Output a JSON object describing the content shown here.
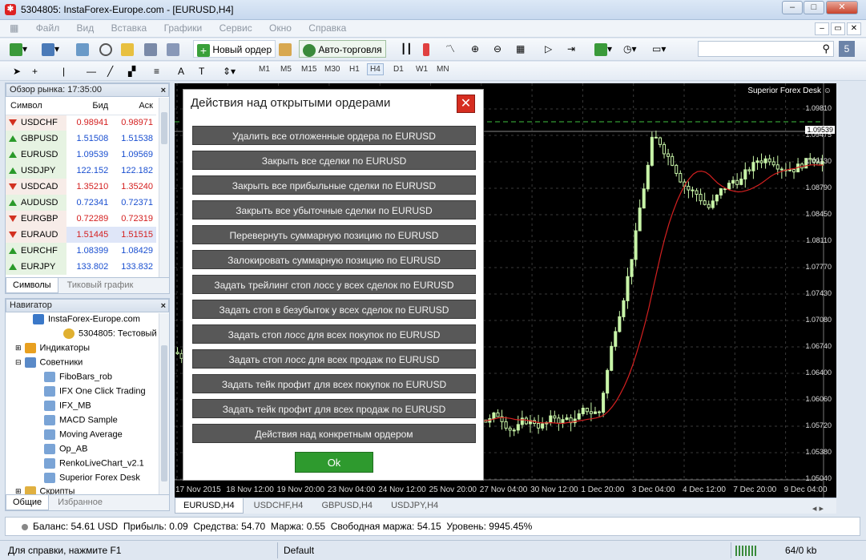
{
  "window": {
    "title": "5304805: InstaForex-Europe.com - [EURUSD,H4]",
    "minimize": "–",
    "maximize": "□",
    "close": "✕"
  },
  "menu": [
    "Файл",
    "Вид",
    "Вставка",
    "Графики",
    "Сервис",
    "Окно",
    "Справка"
  ],
  "toolbar": {
    "new_order": "Новый ордер",
    "auto_trading": "Авто-торговля",
    "timeframes": [
      "M1",
      "M5",
      "M15",
      "M30",
      "H1",
      "H4",
      "D1",
      "W1",
      "MN"
    ],
    "active_timeframe": "H4"
  },
  "market_watch": {
    "title": "Обзор рынка: 17:35:00",
    "close": "×",
    "columns": [
      "Символ",
      "Бид",
      "Аск"
    ],
    "rows": [
      {
        "symbol": "USDCHF",
        "bid": "0.98941",
        "ask": "0.98971",
        "dir": "down"
      },
      {
        "symbol": "GBPUSD",
        "bid": "1.51508",
        "ask": "1.51538",
        "dir": "up"
      },
      {
        "symbol": "EURUSD",
        "bid": "1.09539",
        "ask": "1.09569",
        "dir": "up"
      },
      {
        "symbol": "USDJPY",
        "bid": "122.152",
        "ask": "122.182",
        "dir": "up"
      },
      {
        "symbol": "USDCAD",
        "bid": "1.35210",
        "ask": "1.35240",
        "dir": "down"
      },
      {
        "symbol": "AUDUSD",
        "bid": "0.72341",
        "ask": "0.72371",
        "dir": "up"
      },
      {
        "symbol": "EURGBP",
        "bid": "0.72289",
        "ask": "0.72319",
        "dir": "down"
      },
      {
        "symbol": "EURAUD",
        "bid": "1.51445",
        "ask": "1.51515",
        "dir": "down"
      },
      {
        "symbol": "EURCHF",
        "bid": "1.08399",
        "ask": "1.08429",
        "dir": "up"
      },
      {
        "symbol": "EURJPY",
        "bid": "133.802",
        "ask": "133.832",
        "dir": "up"
      }
    ],
    "tabs": [
      "Символы",
      "Тиковый график"
    ]
  },
  "navigator": {
    "title": "Навигатор",
    "close": "×",
    "items": [
      "InstaForex-Europe.com",
      "5304805: Тестовый",
      "Индикаторы",
      "Советники",
      "FiboBars_rob",
      "IFX One Click Trading",
      "IFX_MB",
      "MACD Sample",
      "Moving Average",
      "Op_AB",
      "RenkoLiveChart_v2.1",
      "Superior Forex Desk",
      "Скрипты"
    ],
    "tabs": [
      "Общие",
      "Избранное"
    ]
  },
  "chart": {
    "expert_label": "Superior Forex Desk ☺",
    "current_price": "1.09539",
    "price_axis": [
      "1.09810",
      "1.09475",
      "1.09130",
      "1.08790",
      "1.08450",
      "1.08110",
      "1.07770",
      "1.07430",
      "1.07080",
      "1.06740",
      "1.06400",
      "1.06060",
      "1.05720",
      "1.05380",
      "1.05040"
    ],
    "time_axis": [
      "17 Nov 2015",
      "18 Nov 12:00",
      "19 Nov 20:00",
      "23 Nov 04:00",
      "24 Nov 12:00",
      "25 Nov 20:00",
      "27 Nov 04:00",
      "30 Nov 12:00",
      "1 Dec 20:00",
      "3 Dec 04:00",
      "4 Dec 12:00",
      "7 Dec 20:00",
      "9 Dec 04:00"
    ],
    "colors": {
      "bull": "#c8f5a8",
      "bear": "#ffffff",
      "ma": "#d42020",
      "grid": "#3a3a3a",
      "level": "#3fbf3f"
    }
  },
  "chart_tabs": [
    "EURUSD,H4",
    "USDCHF,H4",
    "GBPUSD,H4",
    "USDJPY,H4"
  ],
  "account": {
    "text": "Баланс: 54.61 USD  Прибыль: 0.09  Средства: 54.70  Маржа: 0.55  Свободная маржа: 54.15  Уровень: 9945.45%"
  },
  "status": {
    "help": "Для справки, нажмите F1",
    "profile": "Default",
    "traffic": "64/0 kb"
  },
  "dialog": {
    "title": "Действия над открытыми ордерами",
    "close": "✕",
    "buttons": [
      "Удалить все отложенные ордера по EURUSD",
      "Закрыть все сделки по EURUSD",
      "Закрыть все прибыльные сделки по EURUSD",
      "Закрыть все убыточные сделки по EURUSD",
      "Перевернуть суммарную позицию по EURUSD",
      "Залокировать суммарную позицию по EURUSD",
      "Задать трейлинг стоп лосс у всех сделок по EURUSD",
      "Задать стоп в безубыток у всех сделок по EURUSD",
      "Задать стоп лосс для всех покупок по EURUSD",
      "Задать стоп лосс для всех продаж по EURUSD",
      "Задать тейк профит для всех покупок по EURUSD",
      "Задать тейк профит для всех продаж по EURUSD",
      "Действия над конкретным ордером"
    ],
    "ok": "Ok"
  }
}
